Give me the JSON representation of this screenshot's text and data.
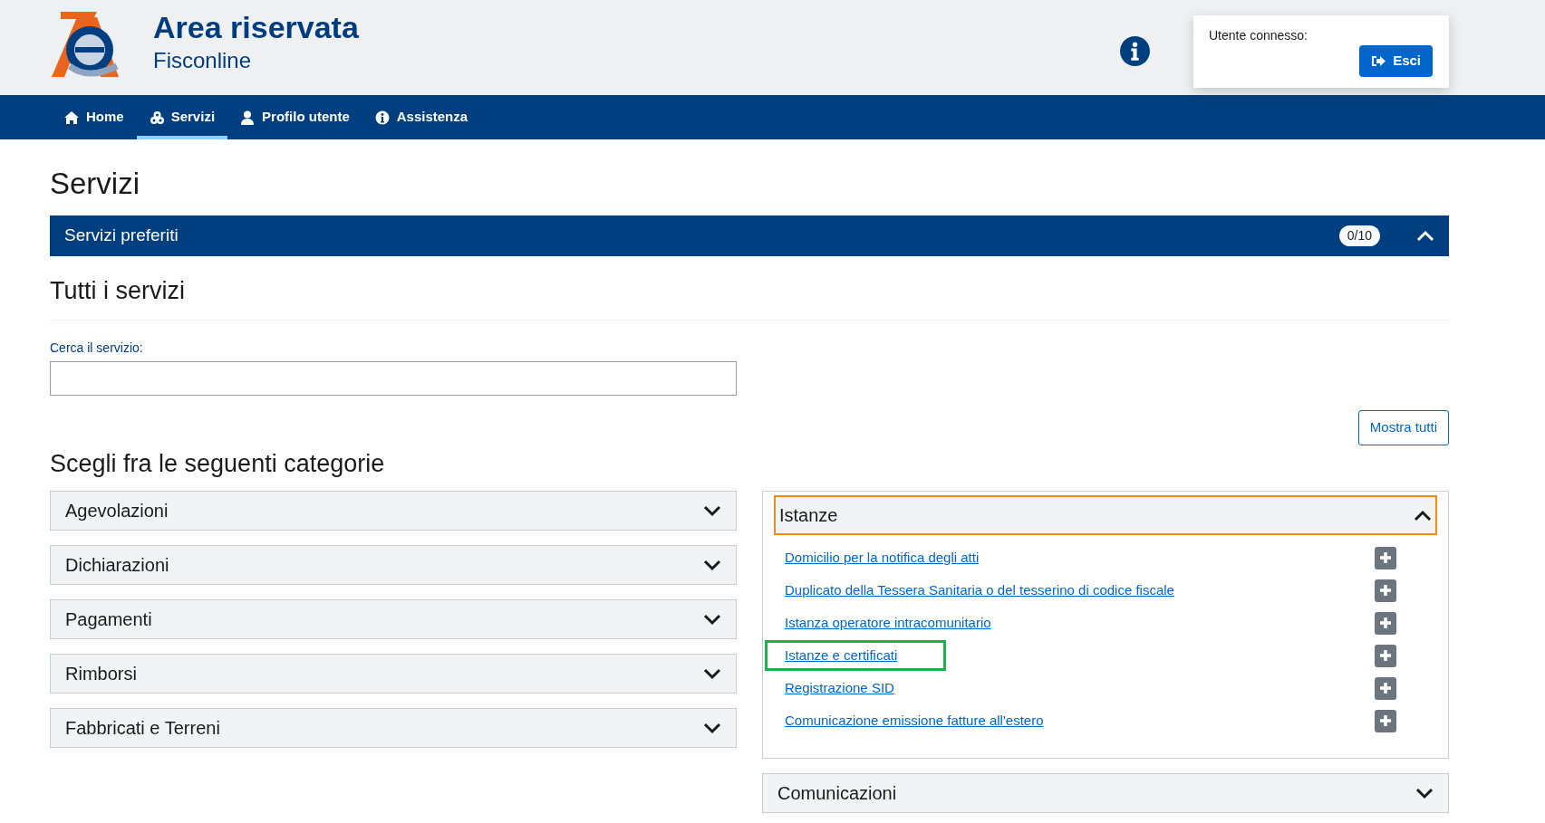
{
  "header": {
    "title": "Area riservata",
    "subtitle": "Fisconline",
    "user_label": "Utente connesso:",
    "logout_button": "Esci"
  },
  "nav": [
    {
      "label": "Home",
      "kind": "home",
      "selected": false
    },
    {
      "label": "Servizi",
      "kind": "services",
      "selected": true
    },
    {
      "label": "Profilo utente",
      "kind": "user",
      "selected": false
    },
    {
      "label": "Assistenza",
      "kind": "info",
      "selected": false
    }
  ],
  "page_title": "Servizi",
  "favorites": {
    "title": "Servizi preferiti",
    "count": "0/10",
    "expanded": true
  },
  "all_services_title": "Tutti i servizi",
  "search": {
    "label": "Cerca il servizio:"
  },
  "show_all_button": "Mostra tutti",
  "categories_title": "Scegli fra le seguenti categorie",
  "categories_left": [
    {
      "title": "Agevolazioni",
      "expanded": false,
      "focused": false
    },
    {
      "title": "Dichiarazioni",
      "expanded": false,
      "focused": false
    },
    {
      "title": "Pagamenti",
      "expanded": false,
      "focused": false
    },
    {
      "title": "Rimborsi",
      "expanded": false,
      "focused": false
    },
    {
      "title": "Fabbricati e Terreni",
      "expanded": false,
      "focused": false
    }
  ],
  "categories_right": [
    {
      "title": "Istanze",
      "expanded": true,
      "focused": true,
      "services": [
        {
          "label": "Domicilio per la notifica degli atti",
          "highlighted": false
        },
        {
          "label": "Duplicato della Tessera Sanitaria o del tesserino di codice fiscale",
          "highlighted": false
        },
        {
          "label": "Istanza operatore intracomunitario",
          "highlighted": false
        },
        {
          "label": "Istanze e certificati",
          "highlighted": true
        },
        {
          "label": "Registrazione SID",
          "highlighted": false
        },
        {
          "label": "Comunicazione emissione fatture all'estero",
          "highlighted": false
        }
      ]
    },
    {
      "title": "Comunicazioni",
      "expanded": false,
      "focused": false
    }
  ]
}
